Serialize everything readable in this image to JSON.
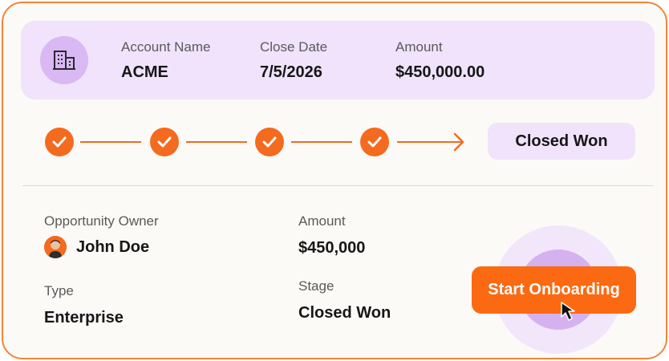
{
  "summary": {
    "icon": "building-icon",
    "account_name_label": "Account Name",
    "account_name_value": "ACME",
    "close_date_label": "Close Date",
    "close_date_value": "7/5/2026",
    "amount_label": "Amount",
    "amount_value": "$450,000.00"
  },
  "progress": {
    "completed_steps": 4,
    "step_icon": "checkmark-icon",
    "current_stage": "Closed Won"
  },
  "details": {
    "owner_label": "Opportunity Owner",
    "owner_name": "John Doe",
    "type_label": "Type",
    "type_value": "Enterprise",
    "amount_label": "Amount",
    "amount_value": "$450,000",
    "stage_label": "Stage",
    "stage_value": "Closed Won"
  },
  "cta": {
    "label": "Start Onboarding"
  },
  "colors": {
    "accent": "#f46a1e",
    "button": "#fb6a12",
    "lavender": "#f0e3fb",
    "lavender_dark": "#d9b8f4"
  }
}
